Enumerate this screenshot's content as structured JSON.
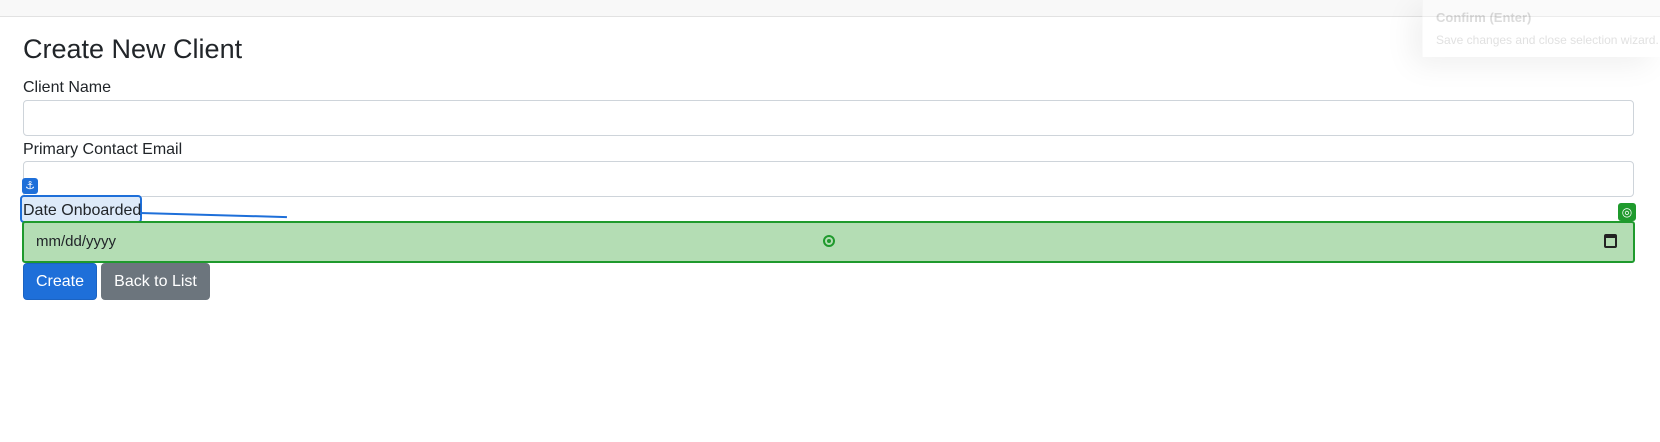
{
  "page": {
    "title": "Create New Client"
  },
  "form": {
    "client_name_label": "Client Name",
    "client_name_value": "",
    "email_label": "Primary Contact Email",
    "email_value": "",
    "date_label": "Date Onboarded",
    "date_placeholder": "mm/dd/yyyy"
  },
  "buttons": {
    "create_label": "Create",
    "back_label": "Back to List"
  },
  "tooltip": {
    "title": "Confirm (Enter)",
    "description": "Save changes and close selection wizard."
  },
  "overlay": {
    "anchor_icon": "anchor-icon",
    "target_icon": "target-icon",
    "anchor_color": "#1e6fd9",
    "target_color": "#1f9a2d",
    "target_fill": "#b4ddb4"
  },
  "colors": {
    "primary": "#1e6fd9",
    "secondary": "#6c757d"
  }
}
